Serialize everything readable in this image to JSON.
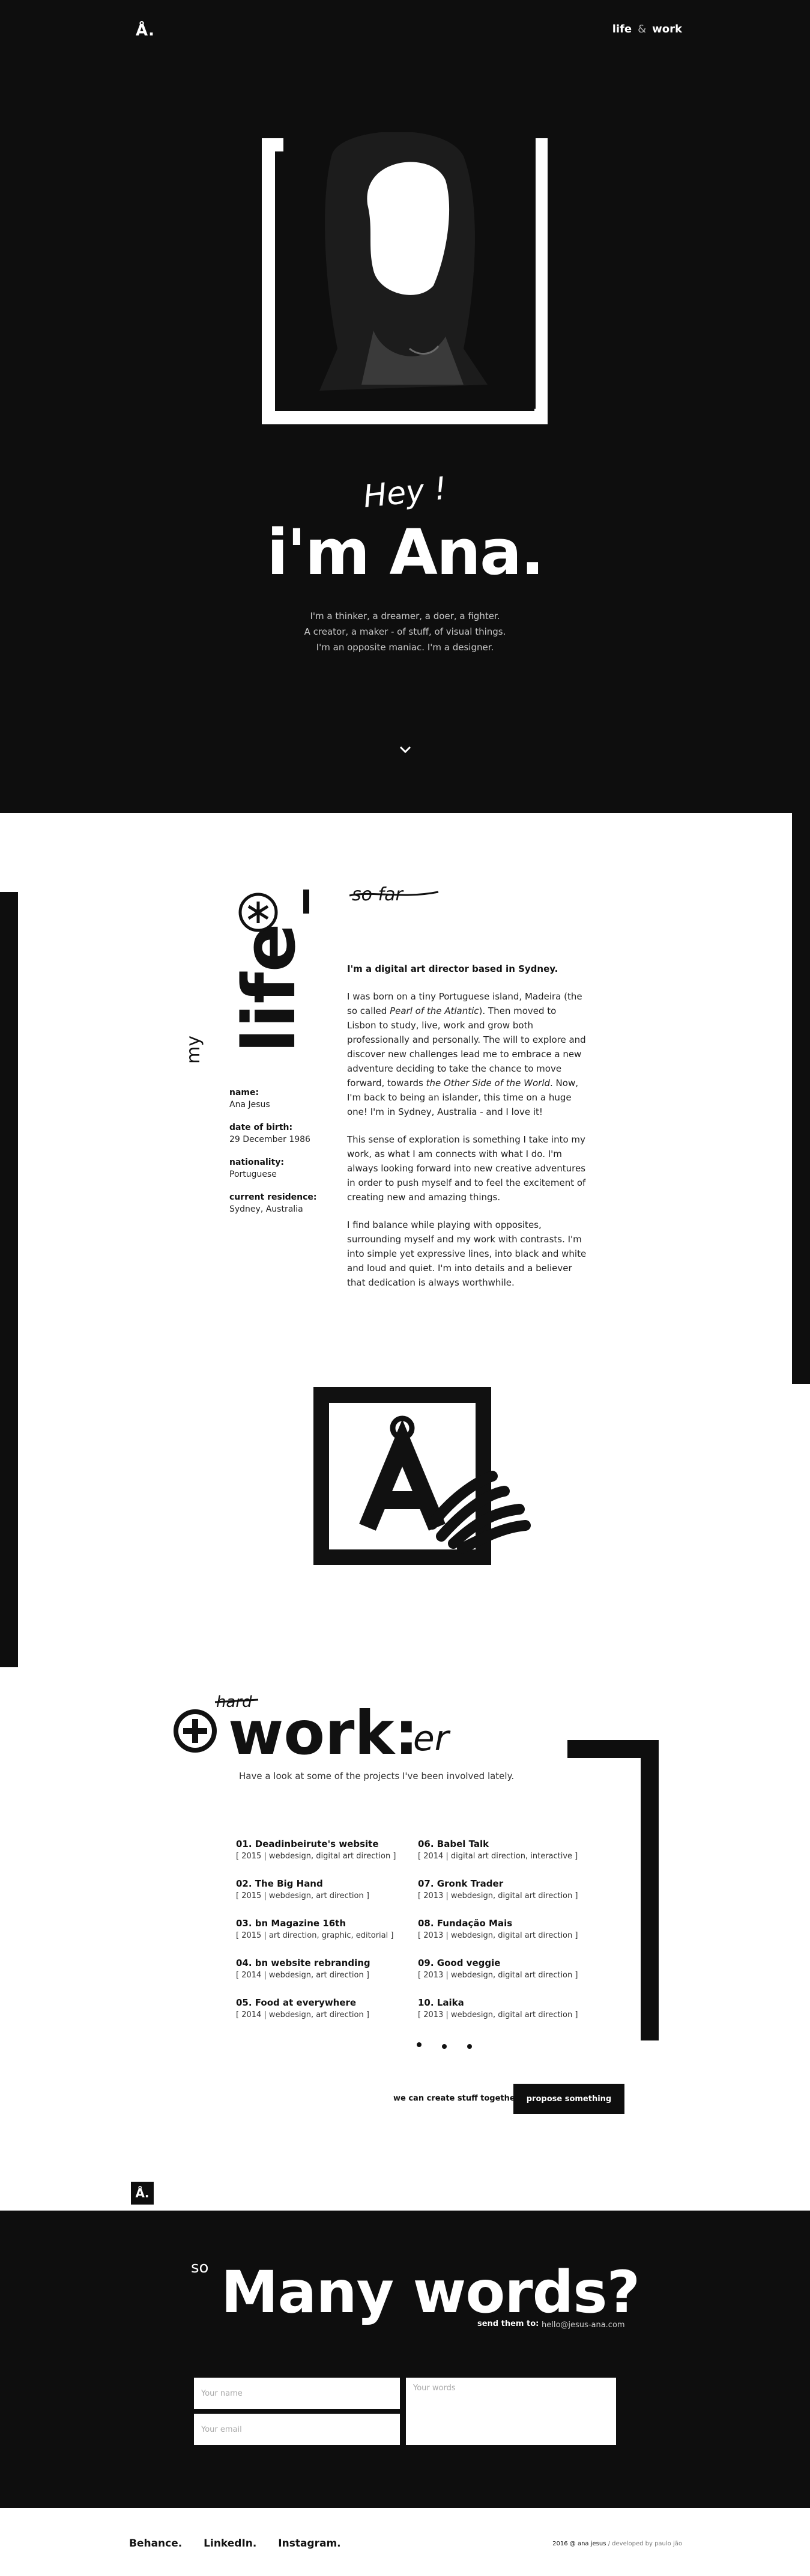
{
  "header": {
    "logo": "Å.",
    "nav_life": "life",
    "nav_amp": "&",
    "nav_work": "work"
  },
  "hero": {
    "greeting": "Hey !",
    "title": "i'm Ana.",
    "intro": [
      "I'm a thinker, a dreamer, a doer, a fighter.",
      "A creator, a maker - of stuff, of visual things.",
      "I'm an opposite maniac. I'm a designer."
    ]
  },
  "life": {
    "heading_small": "my",
    "heading_big": "life",
    "aside_note": "so far",
    "lead": "I'm a digital art director based in Sydney.",
    "paragraph1_a": "I was born on a tiny Portuguese island, Madeira (the so called ",
    "paragraph1_em1": "Pearl of the Atlantic",
    "paragraph1_b": "). Then moved to Lisbon to study, live, work and grow both professionally and personally. The will to explore and discover new challenges lead me to embrace a new adventure deciding to take the chance to move forward, towards ",
    "paragraph1_em2": "the Other Side of the World",
    "paragraph1_c": ". Now, I'm back to being an islander, this time on a huge one! I'm in Sydney, Australia - and I love it!",
    "paragraph2": "This sense of exploration is something I take into my work, as what I am connects with what I do. I'm always looking forward into new creative adventures in order to push myself and to feel the excitement of creating new and amazing things.",
    "paragraph3": "I find balance while playing with opposites, surrounding myself and my work with contrasts. I'm into simple yet expressive lines, into black and white and loud and quiet. I'm into details and a believer that dedication is always worthwhile.",
    "facts": [
      {
        "label": "name:",
        "value": "Ana Jesus"
      },
      {
        "label": "date of birth:",
        "value": "29 December 1986"
      },
      {
        "label": "nationality:",
        "value": "Portuguese"
      },
      {
        "label": "current residence:",
        "value": "Sydney, Australia"
      }
    ]
  },
  "work": {
    "heading_pre": "hard",
    "heading": "work:",
    "heading_suffix": "er",
    "subtitle": "Have a look at some of the projects I've been involved lately.",
    "projects": [
      {
        "title": "01. Deadinbeirute's website",
        "meta": "[ 2015 | webdesign, digital art direction ]"
      },
      {
        "title": "02. The Big Hand",
        "meta": "[ 2015 | webdesign, art direction ]"
      },
      {
        "title": "03. bn Magazine 16th",
        "meta": "[ 2015 | art direction, graphic, editorial ]"
      },
      {
        "title": "04. bn website rebranding",
        "meta": "[ 2014 | webdesign, art direction ]"
      },
      {
        "title": "05. Food at everywhere",
        "meta": "[ 2014 | webdesign, art direction ]"
      },
      {
        "title": "06. Babel Talk",
        "meta": "[ 2014 | digital art direction, interactive ]"
      },
      {
        "title": "07. Gronk Trader",
        "meta": "[ 2013 | webdesign, digital art direction ]"
      },
      {
        "title": "08. Fundação Mais",
        "meta": "[ 2013 | webdesign, digital art direction ]"
      },
      {
        "title": "09. Good veggie",
        "meta": "[ 2013 | webdesign, digital art direction ]"
      },
      {
        "title": "10. Laika",
        "meta": "[ 2013 | webdesign, digital art direction ]"
      }
    ],
    "cta_text": "we can create stuff together",
    "cta_button": "propose something"
  },
  "contact": {
    "logo": "Å.",
    "so": "so",
    "title": "Many words?",
    "send_label": "send them to:",
    "email": "hello@jesus-ana.com",
    "name_placeholder": "Your name",
    "email_placeholder": "Your email",
    "words_placeholder": "Your words"
  },
  "footer": {
    "links": [
      "Behance.",
      "LinkedIn.",
      "Instagram."
    ],
    "credit_a": "2016 @ ana jesus",
    "credit_b": " / developed by paulo jão"
  },
  "colors": {
    "background_dark": "#0e0e0e",
    "background_light": "#ffffff",
    "text_light": "#ffffff"
  },
  "icons": [
    "scroll-down-chevron-icon",
    "asterisk-circle-icon",
    "plus-circle-icon",
    "a-ring-logo-icon"
  ]
}
